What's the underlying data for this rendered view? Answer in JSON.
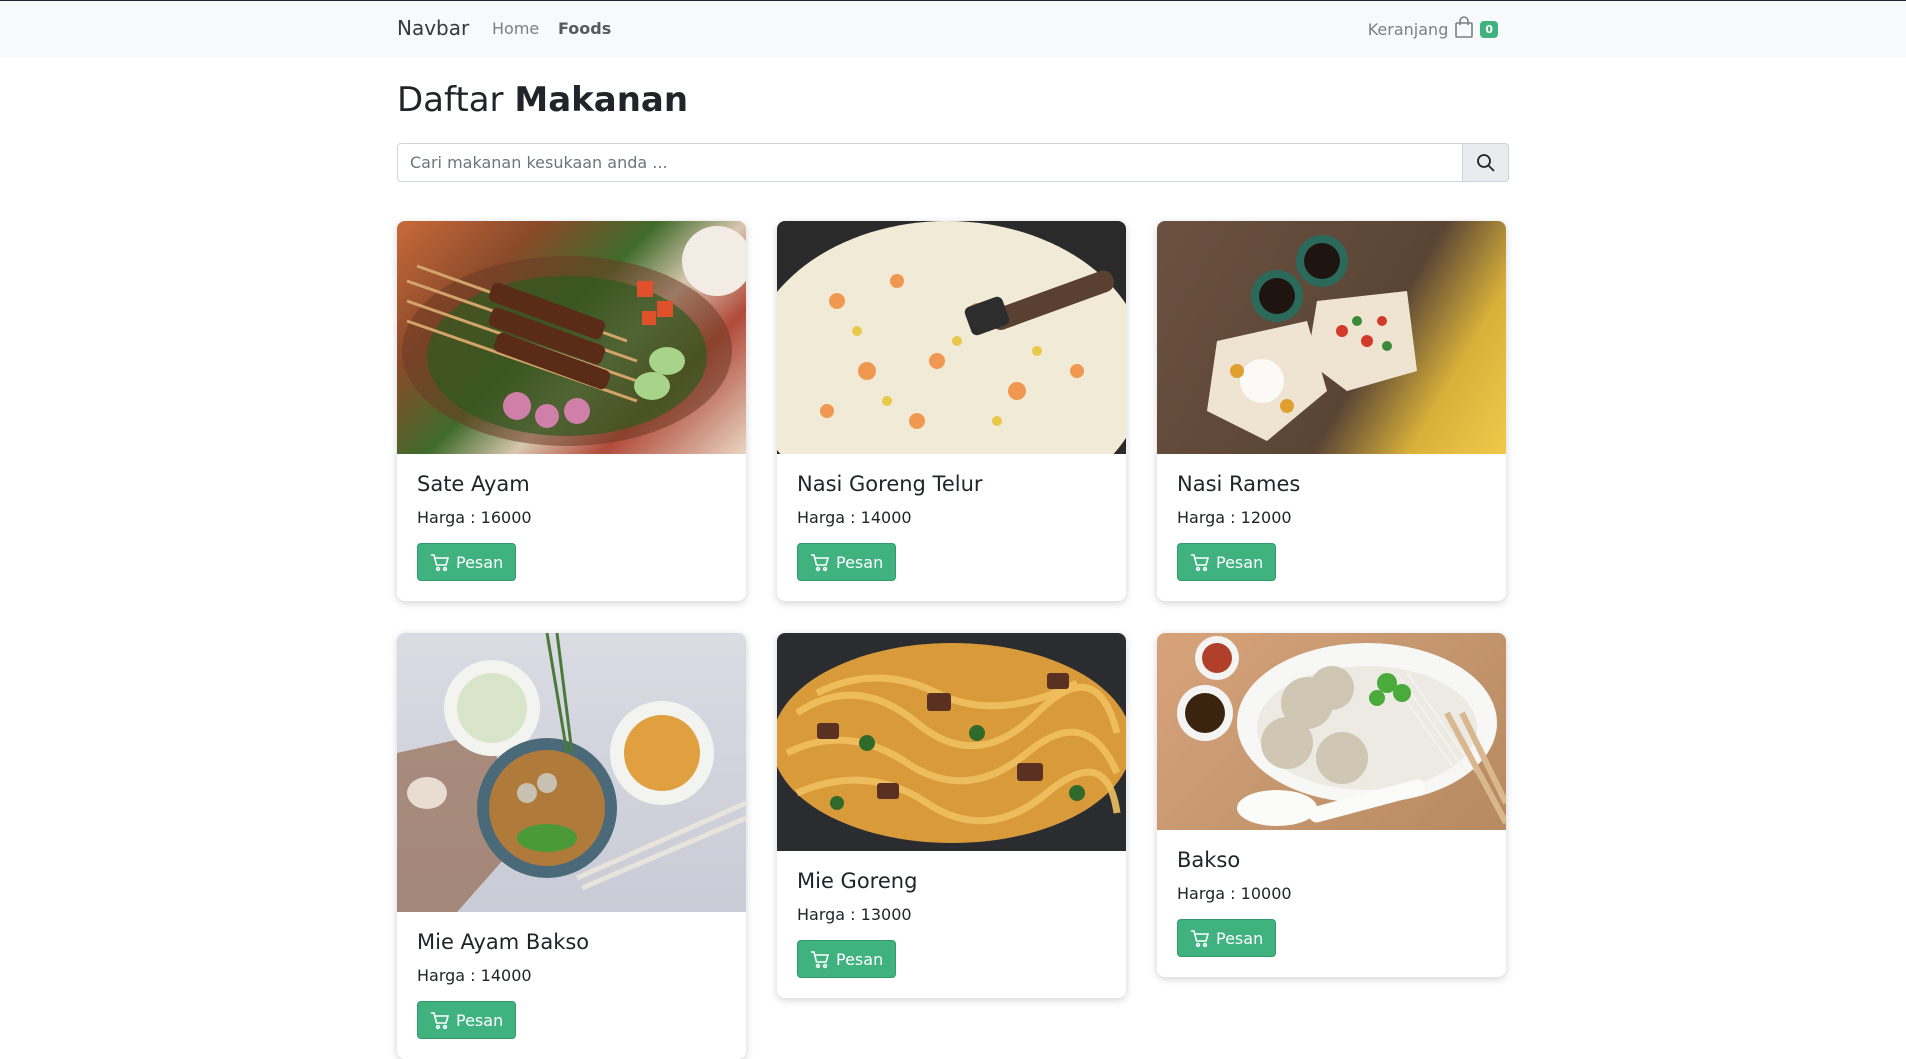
{
  "navbar": {
    "brand": "Navbar",
    "links": [
      {
        "label": "Home",
        "active": false
      },
      {
        "label": "Foods",
        "active": true
      }
    ],
    "cart_label": "Keranjang",
    "cart_count": "0"
  },
  "page": {
    "title_light": "Daftar",
    "title_bold": "Makanan"
  },
  "search": {
    "placeholder": "Cari makanan kesukaan anda ..."
  },
  "button_label": "Pesan",
  "foods": [
    {
      "name": "Sate Ayam",
      "price": "Harga : 16000"
    },
    {
      "name": "Nasi Goreng Telur",
      "price": "Harga : 14000"
    },
    {
      "name": "Nasi Rames",
      "price": "Harga : 12000"
    },
    {
      "name": "Mie Ayam Bakso",
      "price": "Harga : 14000"
    },
    {
      "name": "Mie Goreng",
      "price": "Harga : 13000"
    },
    {
      "name": "Bakso",
      "price": "Harga : 10000"
    }
  ],
  "colors": {
    "accent": "#3fb27f",
    "navbar_bg": "#f8f9fa"
  }
}
